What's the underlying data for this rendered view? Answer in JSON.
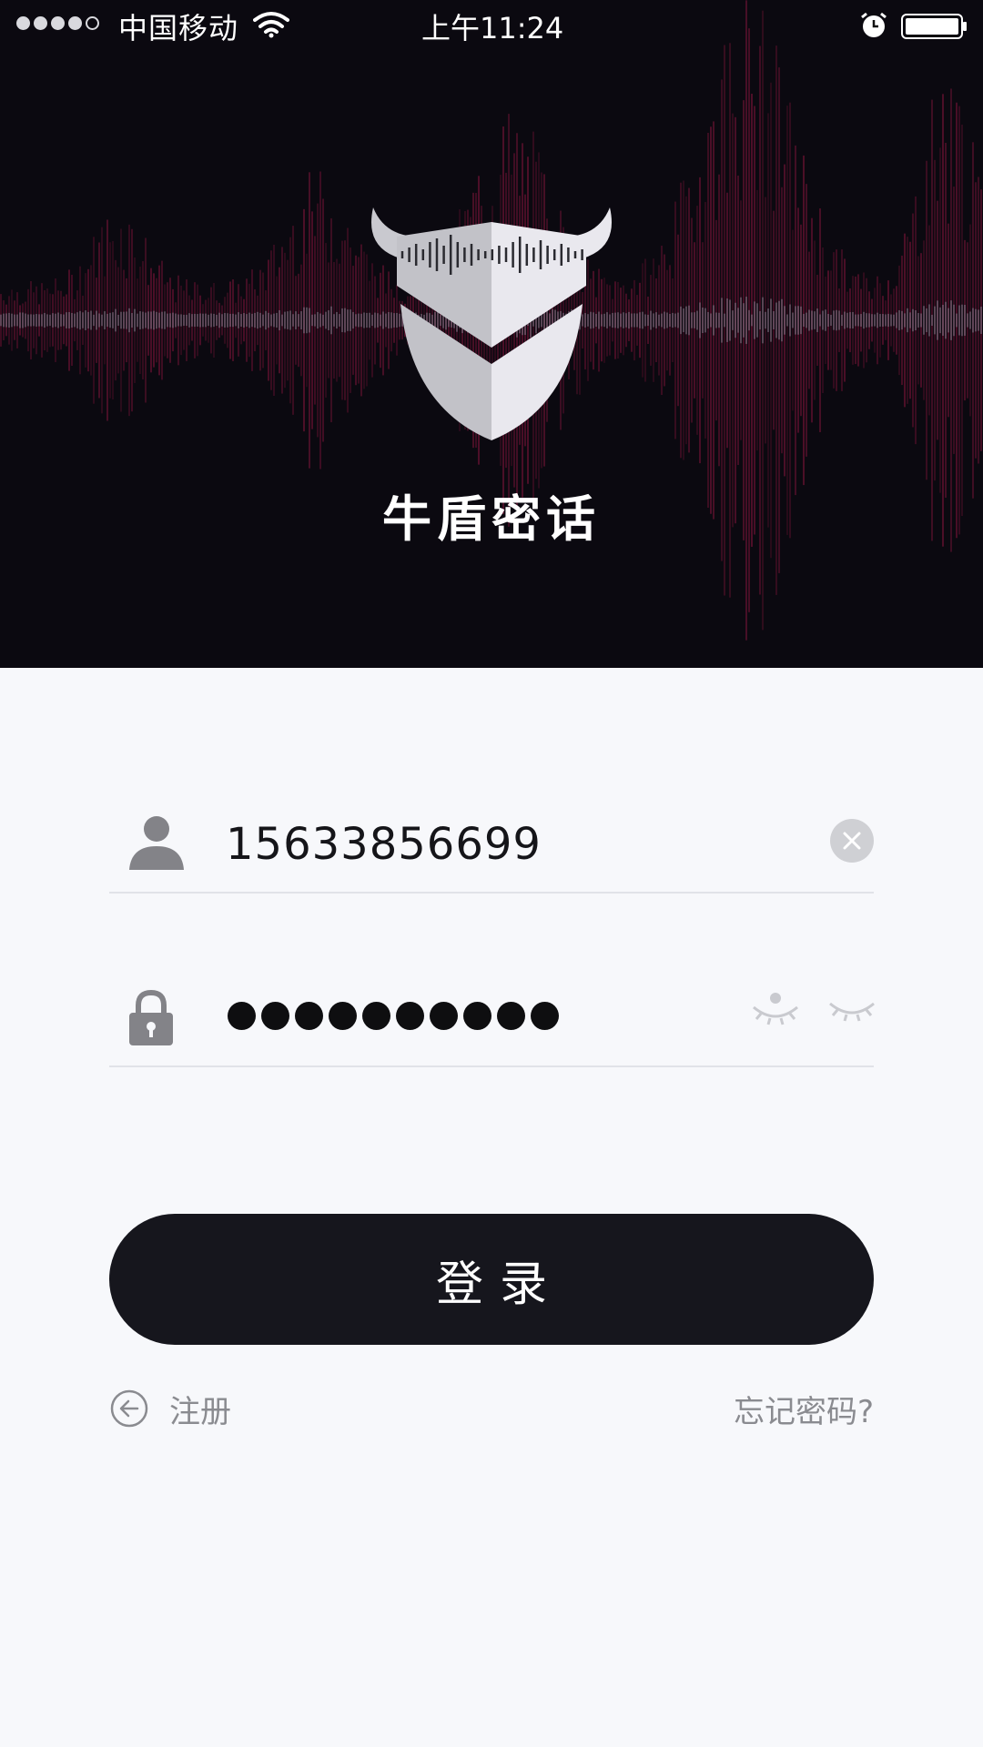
{
  "status_bar": {
    "carrier": "中国移动",
    "time": "上午11:24",
    "icons": [
      "signal-dots",
      "wifi-icon",
      "alarm-icon",
      "battery-icon"
    ]
  },
  "app": {
    "name": "牛盾密话",
    "logo": "bull-shield-logo"
  },
  "login_form": {
    "username_value": "15633856699",
    "password_mask_length": 10,
    "icons": {
      "username": "user-icon",
      "password": "lock-icon",
      "clear": "clear-icon",
      "show_password": "eye-open-icon",
      "hide_password": "eye-closed-icon"
    },
    "login_label": "登录",
    "register_label": "注册",
    "forgot_label": "忘记密码?"
  },
  "colors": {
    "hero_background": "#0b0910",
    "wave_accent": "#7a1438",
    "page_background": "#f7f8fb",
    "button": "#16161d",
    "muted_text": "#8a8b90"
  }
}
